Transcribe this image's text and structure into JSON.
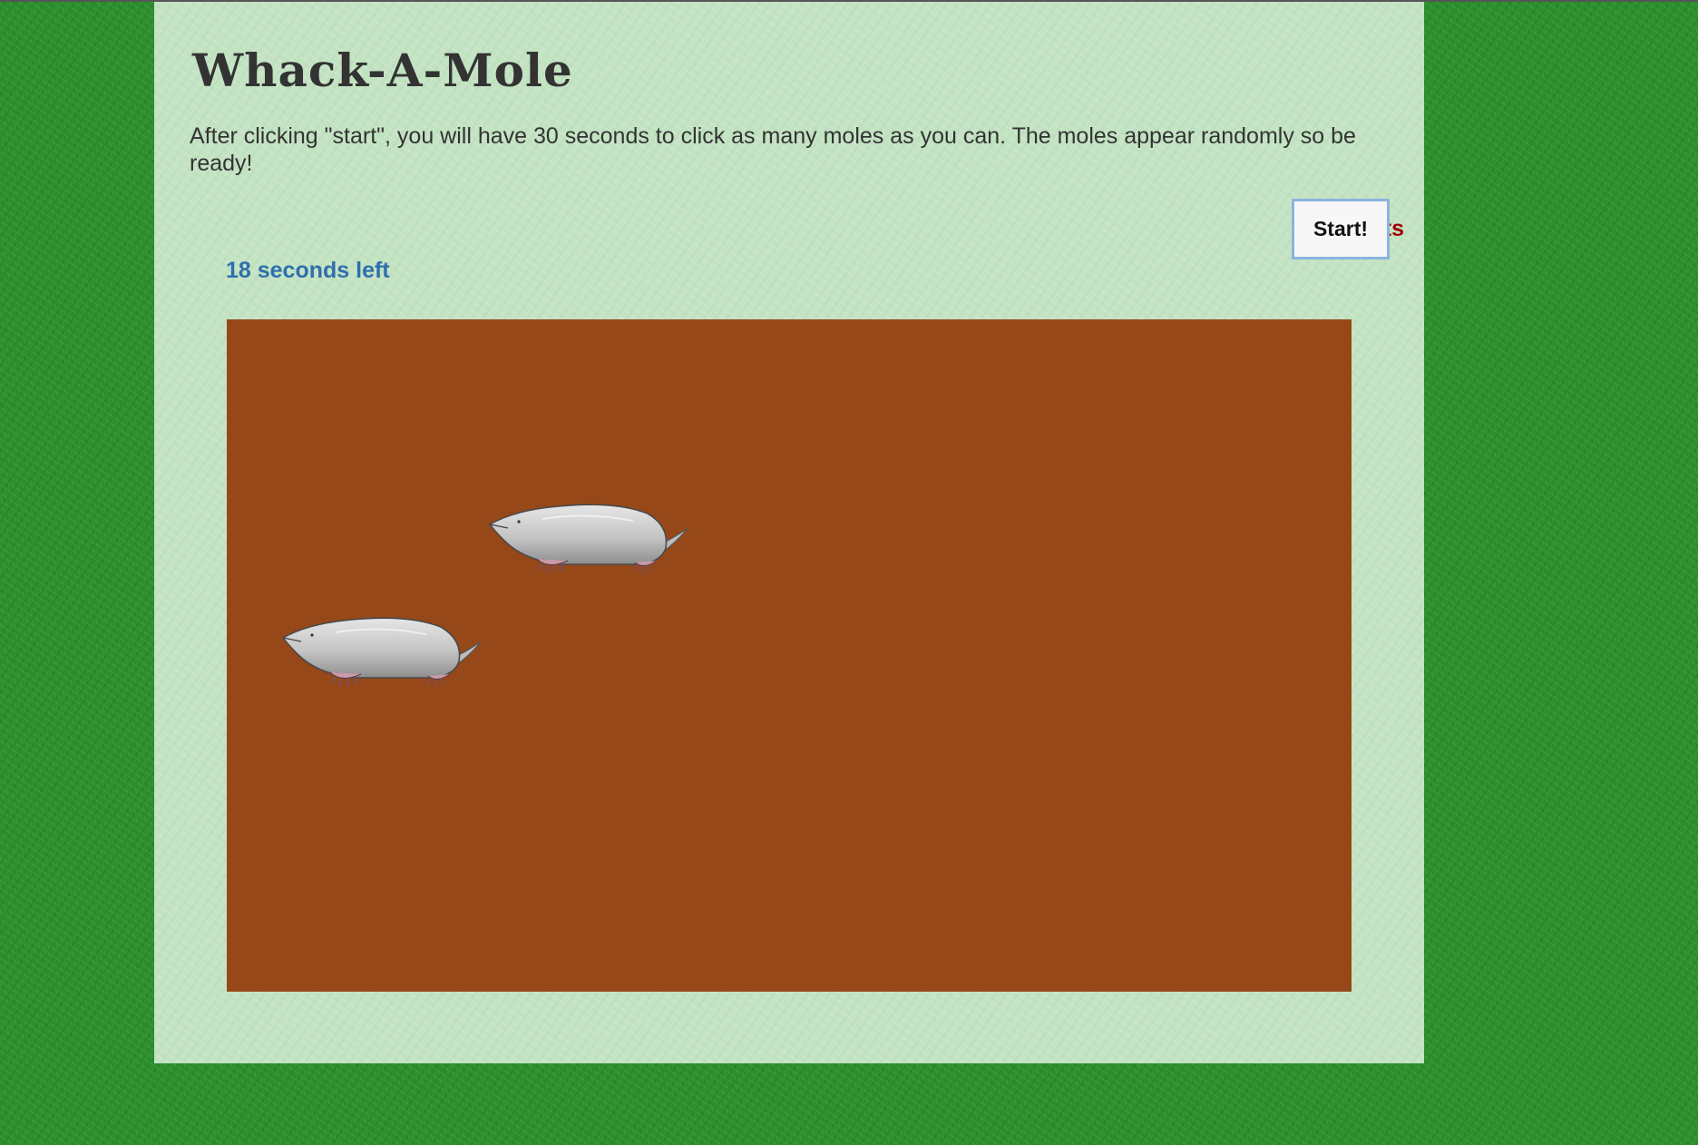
{
  "game": {
    "title": "Whack-A-Mole",
    "instructions": "After clicking \"start\", you will have 30 seconds to click as many moles as you can. The moles appear randomly so be ready!",
    "score_label": "0 pts",
    "start_button_label": "Start!",
    "timer_label": "18 seconds left"
  },
  "colors": {
    "page_grass": "#2a8f2a",
    "panel": "#c3e3c3",
    "board_dirt": "#964818",
    "score_text": "#a10000",
    "timer_text": "#2f6fae",
    "mole_body": "#c9c9c9"
  },
  "board": {
    "visible_moles": [
      {
        "icon": "mole-icon"
      },
      {
        "icon": "mole-icon"
      }
    ]
  }
}
